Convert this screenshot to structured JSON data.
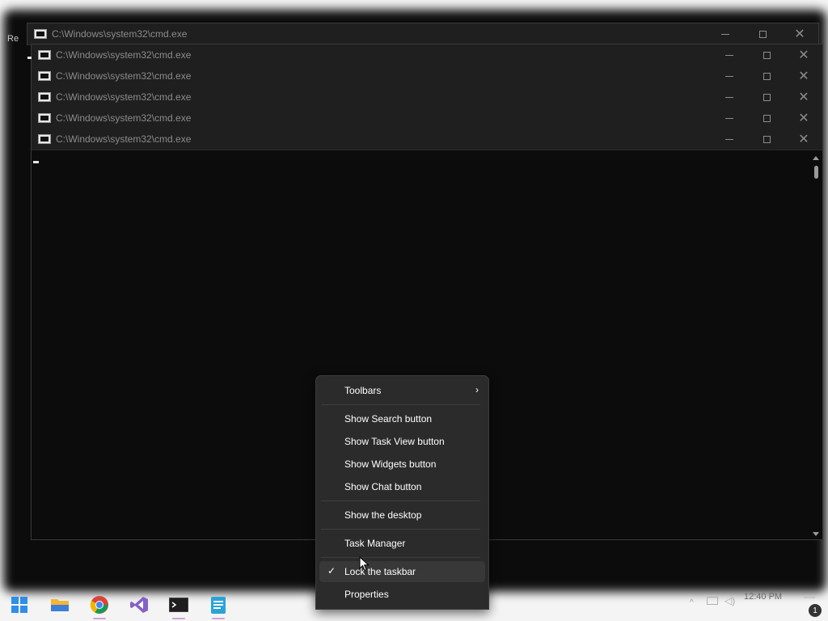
{
  "desktop": {
    "label": "Re"
  },
  "windows": [
    {
      "title": "C:\\Windows\\system32\\cmd.exe"
    },
    {
      "title": "C:\\Windows\\system32\\cmd.exe"
    },
    {
      "title": "C:\\Windows\\system32\\cmd.exe"
    },
    {
      "title": "C:\\Windows\\system32\\cmd.exe"
    },
    {
      "title": "C:\\Windows\\system32\\cmd.exe"
    },
    {
      "title": "C:\\Windows\\system32\\cmd.exe"
    }
  ],
  "window_controls": {
    "close_glyph": "✕"
  },
  "context_menu": {
    "toolbars": "Toolbars",
    "toolbars_arrow": "›",
    "show_search": "Show Search button",
    "show_task_view": "Show Task View button",
    "show_widgets": "Show Widgets button",
    "show_chat": "Show Chat button",
    "show_desktop": "Show the desktop",
    "task_manager": "Task Manager",
    "lock_taskbar": "Lock the taskbar",
    "lock_taskbar_checked": "✓",
    "properties": "Properties"
  },
  "taskbar": {
    "apps": [
      "start",
      "file-explorer",
      "chrome",
      "visual-studio",
      "terminal",
      "notepad"
    ],
    "clock": "12:40 PM",
    "tray_up": "^",
    "notification_count": "1"
  },
  "colors": {
    "console_bg": "#0c0c0c",
    "titlebar_bg": "#1f1f1f",
    "menu_bg": "#2b2b2b",
    "menu_hover": "#383838"
  }
}
